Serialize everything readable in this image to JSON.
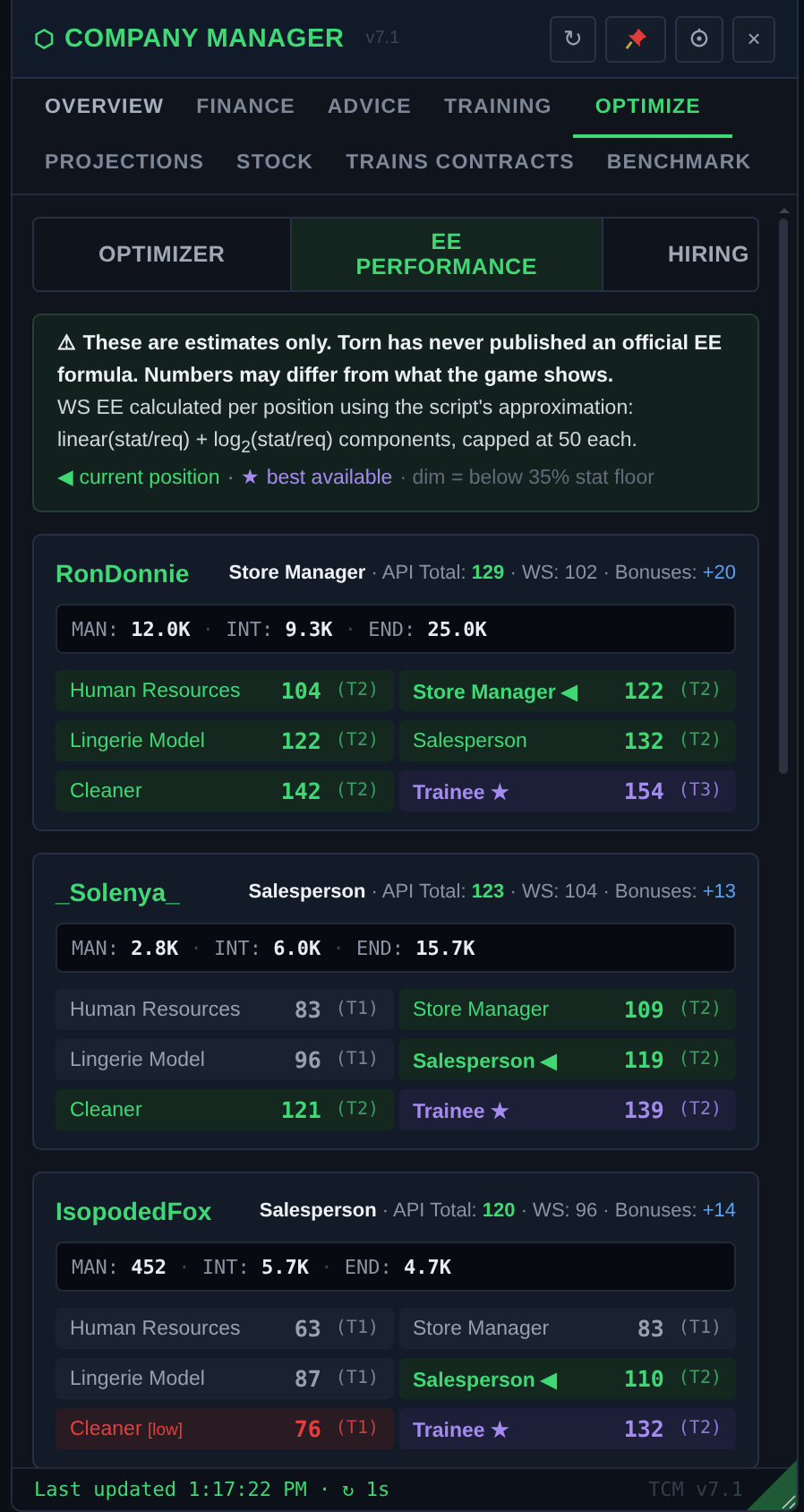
{
  "header": {
    "logo": "⬡",
    "title": "COMPANY MANAGER",
    "version": "v7.1",
    "buttons": [
      {
        "kind": "refresh",
        "label": "↻"
      },
      {
        "kind": "pin"
      },
      {
        "kind": "settings"
      },
      {
        "kind": "close",
        "label": "×"
      }
    ]
  },
  "tabs": [
    {
      "label": "OVERVIEW",
      "selected": false
    },
    {
      "label": "FINANCE",
      "selected": false
    },
    {
      "label": "ADVICE",
      "selected": false
    },
    {
      "label": "TRAINING",
      "selected": false
    },
    {
      "label": "OPTIMIZE",
      "selected": true
    },
    {
      "label": "PROJECTIONS",
      "selected": false
    },
    {
      "label": "STOCK",
      "selected": false
    },
    {
      "label": "TRAINS CONTRACTS",
      "selected": false
    },
    {
      "label": "BENCHMARK",
      "selected": false
    }
  ],
  "subtabs": [
    {
      "label": "OPTIMIZER",
      "selected": false
    },
    {
      "label": "EE PERFORMANCE",
      "selected": true
    },
    {
      "label": "HIRING",
      "selected": false
    }
  ],
  "notice": {
    "title": "⚠ These are estimates only. Torn has never published an official EE formula. Numbers may differ from what the game shows.",
    "body": "WS EE calculated per position using the script's approximation: linear(stat/req) + log$_{2}$(stat/req) components, capped at 50 each.",
    "legend": [
      {
        "kind": "current",
        "text": "◀ current position"
      },
      {
        "kind": "sep",
        "text": "·"
      },
      {
        "kind": "best",
        "text": "★ best available"
      },
      {
        "kind": "dim",
        "text": "· dim = below 35% stat floor"
      }
    ]
  },
  "employees": [
    {
      "name": "RonDonnie",
      "stats_separator": "·",
      "summary": [
        {
          "kind": "role",
          "text": "Store Manager"
        },
        {
          "kind": "plain",
          "text": " · API Total: "
        },
        {
          "kind": "good",
          "text": "129"
        },
        {
          "kind": "plain",
          "text": " · WS: 102 · Bonuses: "
        },
        {
          "kind": "bonus",
          "text": "+20"
        }
      ],
      "stats": [
        {
          "label": "MAN:",
          "value": "12.0K"
        },
        {
          "label": "INT:",
          "value": "9.3K"
        },
        {
          "label": "END:",
          "value": "25.0K"
        }
      ],
      "positions": [
        {
          "name": "Human Resources",
          "score": "104",
          "tier": "(T2)",
          "kind": "good"
        },
        {
          "name": "Store Manager",
          "marker": "◀",
          "score": "122",
          "tier": "(T2)",
          "kind": "current"
        },
        {
          "name": "Lingerie Model",
          "score": "122",
          "tier": "(T2)",
          "kind": "good"
        },
        {
          "name": "Salesperson",
          "score": "132",
          "tier": "(T2)",
          "kind": "good"
        },
        {
          "name": "Cleaner",
          "score": "142",
          "tier": "(T2)",
          "kind": "good"
        },
        {
          "name": "Trainee",
          "marker": "★",
          "score": "154",
          "tier": "(T3)",
          "kind": "best"
        }
      ]
    },
    {
      "name": "_Solenya_",
      "stats_separator": "·",
      "summary": [
        {
          "kind": "role",
          "text": "Salesperson"
        },
        {
          "kind": "plain",
          "text": " · API Total: "
        },
        {
          "kind": "good",
          "text": "123"
        },
        {
          "kind": "plain",
          "text": " · WS: 104 · Bonuses: "
        },
        {
          "kind": "bonus",
          "text": "+13"
        }
      ],
      "stats": [
        {
          "label": "MAN:",
          "value": "2.8K"
        },
        {
          "label": "INT:",
          "value": "6.0K"
        },
        {
          "label": "END:",
          "value": "15.7K"
        }
      ],
      "positions": [
        {
          "name": "Human Resources",
          "score": "83",
          "tier": "(T1)",
          "kind": "neutral"
        },
        {
          "name": "Store Manager",
          "score": "109",
          "tier": "(T2)",
          "kind": "good"
        },
        {
          "name": "Lingerie Model",
          "score": "96",
          "tier": "(T1)",
          "kind": "neutral"
        },
        {
          "name": "Salesperson",
          "marker": "◀",
          "score": "119",
          "tier": "(T2)",
          "kind": "current"
        },
        {
          "name": "Cleaner",
          "score": "121",
          "tier": "(T2)",
          "kind": "good"
        },
        {
          "name": "Trainee",
          "marker": "★",
          "score": "139",
          "tier": "(T2)",
          "kind": "best"
        }
      ]
    },
    {
      "name": "IsopodedFox",
      "stats_separator": "·",
      "summary": [
        {
          "kind": "role",
          "text": "Salesperson"
        },
        {
          "kind": "plain",
          "text": " · API Total: "
        },
        {
          "kind": "good",
          "text": "120"
        },
        {
          "kind": "plain",
          "text": " · WS: 96 · Bonuses: "
        },
        {
          "kind": "bonus",
          "text": "+14"
        }
      ],
      "stats": [
        {
          "label": "MAN:",
          "value": "452"
        },
        {
          "label": "INT:",
          "value": "5.7K"
        },
        {
          "label": "END:",
          "value": "4.7K"
        }
      ],
      "positions": [
        {
          "name": "Human Resources",
          "score": "63",
          "tier": "(T1)",
          "kind": "neutral"
        },
        {
          "name": "Store Manager",
          "score": "83",
          "tier": "(T1)",
          "kind": "neutral"
        },
        {
          "name": "Lingerie Model",
          "score": "87",
          "tier": "(T1)",
          "kind": "neutral"
        },
        {
          "name": "Salesperson",
          "marker": "◀",
          "score": "110",
          "tier": "(T2)",
          "kind": "current"
        },
        {
          "name": "Cleaner",
          "tag": "[low]",
          "score": "76",
          "tier": "(T1)",
          "kind": "low"
        },
        {
          "name": "Trainee",
          "marker": "★",
          "score": "132",
          "tier": "(T2)",
          "kind": "best"
        }
      ]
    }
  ],
  "footer": {
    "status": "Last updated 1:17:22 PM · ↻ 1s",
    "version": "TCM v7.1"
  }
}
